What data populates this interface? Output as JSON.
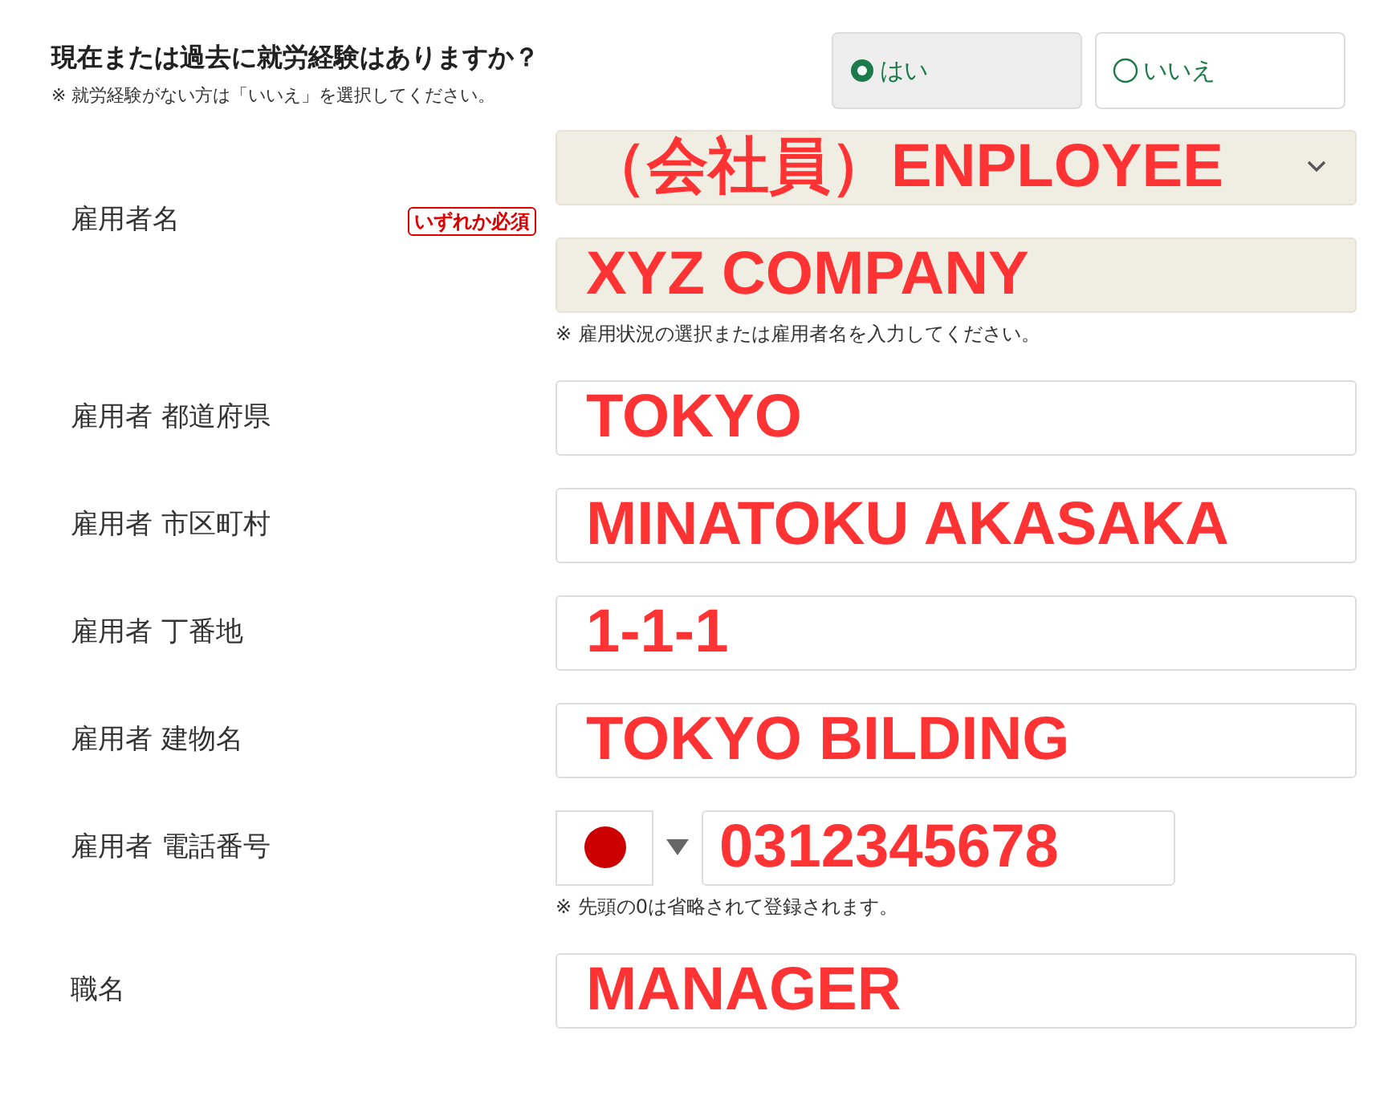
{
  "question": {
    "title": "現在または過去に就労経験はありますか？",
    "note": "※ 就労経験がない方は「いいえ」を選択してください。"
  },
  "options": [
    {
      "label": "はい",
      "selected": true
    },
    {
      "label": "いいえ",
      "selected": false
    }
  ],
  "employer": {
    "label": "雇用者名",
    "badge": "いずれか必須",
    "select_value": "（会社員）ENPLOYEE",
    "input_value": "XYZ COMPANY",
    "note": "※ 雇用状況の選択または雇用者名を入力してください。"
  },
  "rows": [
    {
      "kind": "text",
      "label": "雇用者 都道府県",
      "value": "TOKYO"
    },
    {
      "kind": "text",
      "label": "雇用者 市区町村",
      "value": "MINATOKU AKASAKA"
    },
    {
      "kind": "text",
      "label": "雇用者 丁番地",
      "value": "1-1-1"
    },
    {
      "kind": "text",
      "label": "雇用者 建物名",
      "value": "TOKYO BILDING"
    },
    {
      "kind": "phone",
      "label": "雇用者 電話番号",
      "value": "0312345678",
      "note": "※ 先頭の0は省略されて登録されます。"
    },
    {
      "kind": "text",
      "label": "職名",
      "value": "MANAGER"
    }
  ]
}
